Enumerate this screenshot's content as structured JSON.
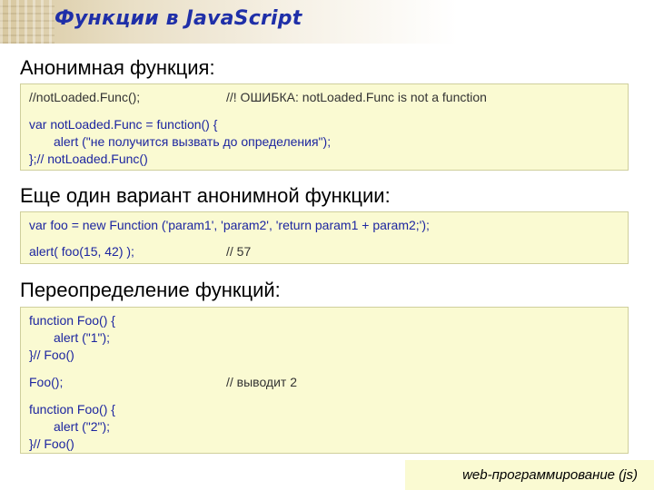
{
  "header": {
    "title": "Функции в JavaScript"
  },
  "section1": {
    "heading": "Анонимная функция:",
    "call": "//notLoaded.Func();",
    "call_comment": "//! ОШИБКА: notLoaded.Func is not a function",
    "def_line1": "var notLoaded.Func = function() {",
    "def_line2": "alert (\"не получится вызвать до определения\");",
    "def_line3": "};// notLoaded.Func()"
  },
  "section2": {
    "heading": "Еще один вариант анонимной функции:",
    "line1": "var foo = new Function ('param1', 'param2', 'return param1 + param2;');",
    "line2": "alert( foo(15, 42) );",
    "line2_comment": "// 57"
  },
  "section3": {
    "heading": "Переопределение функций:",
    "a_line1": "function Foo() {",
    "a_line2": "alert (\"1\");",
    "a_line3": "}// Foo()",
    "call": "Foo();",
    "call_comment": "// выводит 2",
    "b_line1": "function Foo() {",
    "b_line2": "alert (\"2\");",
    "b_line3": "}// Foo()"
  },
  "footer": {
    "text": "web-программирование (js)"
  }
}
